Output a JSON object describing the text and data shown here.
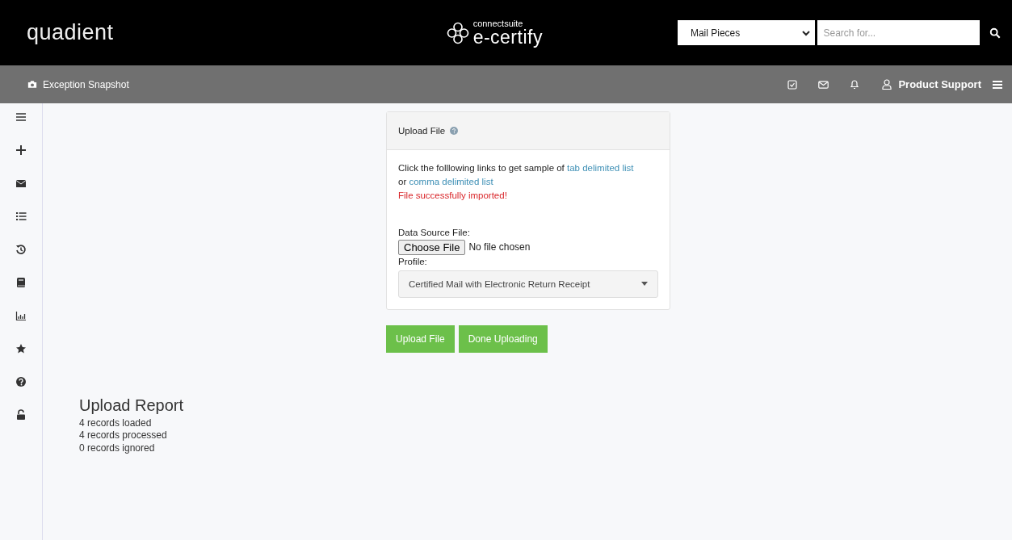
{
  "header": {
    "logo": "quadient",
    "brand_small": "connectsuite",
    "brand": "e-certify",
    "search_scope": "Mail Pieces",
    "search": {
      "placeholder": "Search for..."
    }
  },
  "subbar": {
    "title": "Exception Snapshot",
    "user": "Product Support"
  },
  "upload_panel": {
    "title": "Upload File",
    "intro": "Click the folllowing links to get sample of",
    "links": [
      "tab delimited list",
      "comma delimited list"
    ],
    "connector": "or",
    "message": "File successfully imported!",
    "data_source_label": "Data Source File:",
    "choose_button": "Choose File",
    "file_status": "No file chosen",
    "profile_label": "Profile:",
    "profile": "Certified Mail with Electronic Return Receipt"
  },
  "buttons": [
    "Upload File",
    "Done Uploading"
  ],
  "report": {
    "title": "Upload Report",
    "lines": [
      "4 records loaded",
      "4 records processed",
      "0 records ignored"
    ]
  }
}
